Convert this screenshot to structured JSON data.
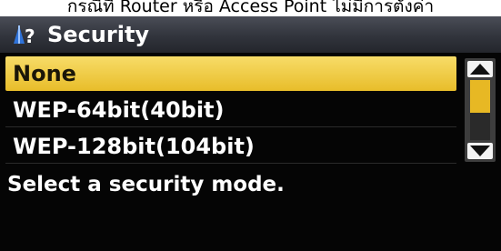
{
  "caption": "กรณีที่ Router หรือ Access Point ไม่มีการตั้งค่า",
  "header": {
    "title": "Security",
    "icon": "wireless-settings-icon"
  },
  "security_options": [
    {
      "label": "None",
      "selected": true
    },
    {
      "label": "WEP-64bit(40bit)",
      "selected": false
    },
    {
      "label": "WEP-128bit(104bit)",
      "selected": false
    }
  ],
  "scrollbar": {
    "up_icon": "arrow-up-icon",
    "down_icon": "arrow-down-icon"
  },
  "message": "Select a security mode.",
  "colors": {
    "selected_highlight": "#efcc45",
    "screen_background": "#050505",
    "scroll_thumb": "#e7b824"
  }
}
